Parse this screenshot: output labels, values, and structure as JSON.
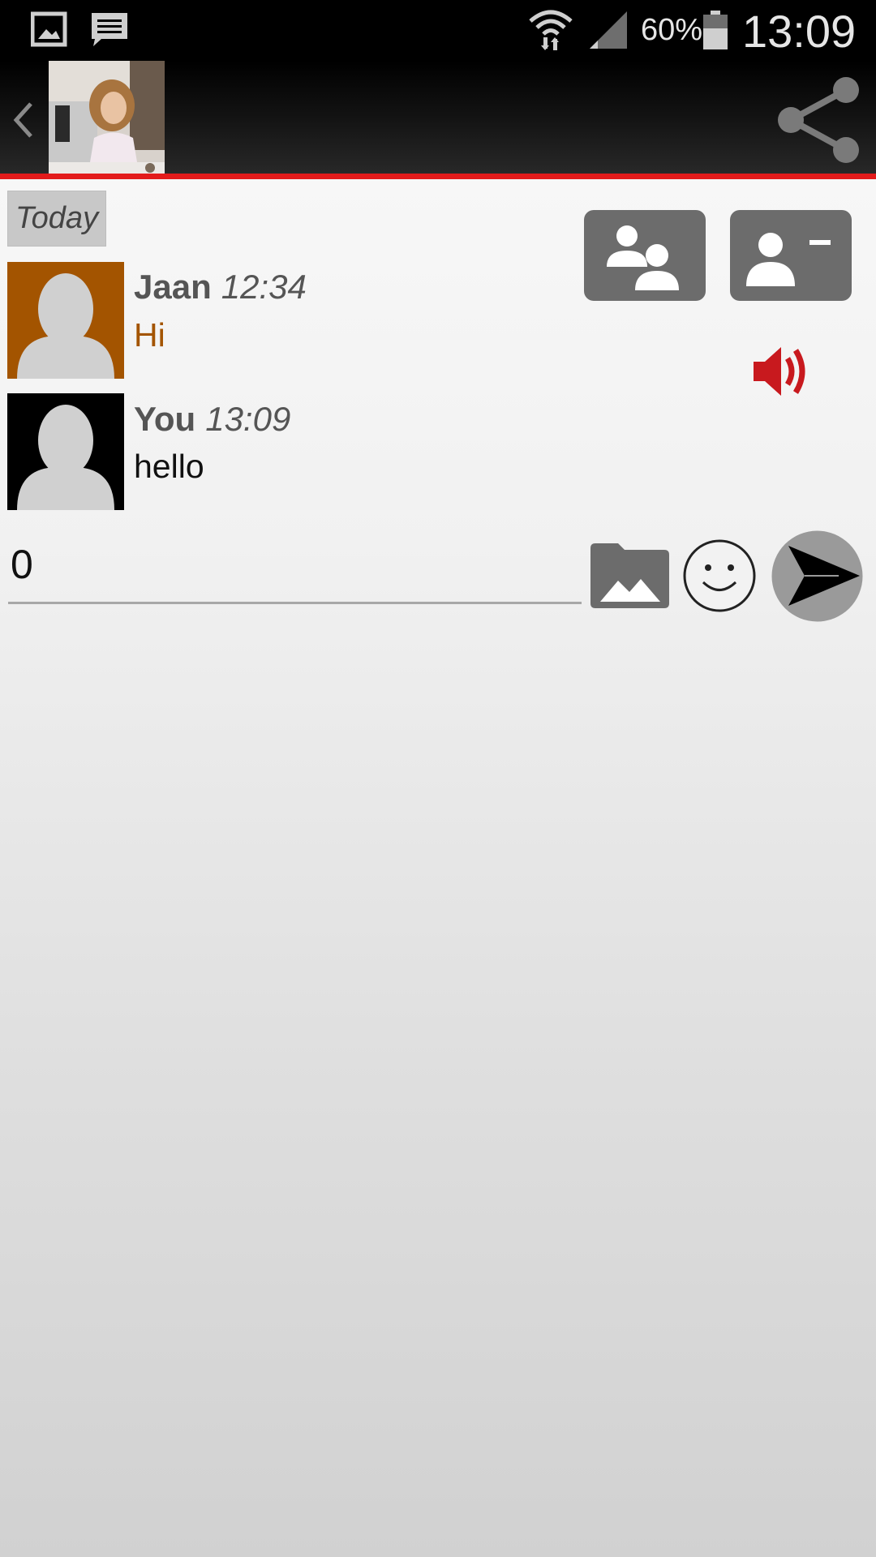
{
  "status_bar": {
    "battery_percent": "60%",
    "time": "13:09",
    "icons": [
      "gallery-notification-icon",
      "message-notification-icon",
      "wifi-icon",
      "signal-icon",
      "battery-icon"
    ]
  },
  "header": {
    "icons": [
      "back-arrow-icon",
      "contact-photo",
      "share-icon"
    ],
    "accent_color": "#e31b1b"
  },
  "date_divider": "Today",
  "actions": {
    "icons": [
      "group-chat-icon",
      "remove-contact-icon",
      "speaker-icon"
    ],
    "speaker_color": "#c8191e"
  },
  "messages": [
    {
      "sender": "Jaan",
      "time": "12:34",
      "text": "Hi",
      "text_color": "#a35400",
      "avatar_bg": "#a35400"
    },
    {
      "sender": "You",
      "time": "13:09",
      "text": "hello",
      "text_color": "#111111",
      "avatar_bg": "#000000"
    }
  ],
  "composer": {
    "value": "0",
    "icons": [
      "gallery-icon",
      "emoji-icon",
      "send-icon"
    ]
  }
}
